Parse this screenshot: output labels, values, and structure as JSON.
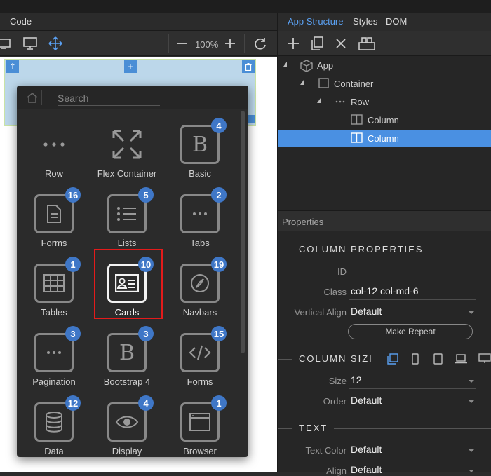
{
  "editor": {
    "code_tab": "Code",
    "zoom": "100%"
  },
  "popup": {
    "search_placeholder": "Search",
    "items": [
      {
        "label": "Row",
        "badge": ""
      },
      {
        "label": "Flex Container",
        "badge": ""
      },
      {
        "label": "Basic",
        "badge": "4"
      },
      {
        "label": "Forms",
        "badge": "16"
      },
      {
        "label": "Lists",
        "badge": "5"
      },
      {
        "label": "Tabs",
        "badge": "2"
      },
      {
        "label": "Tables",
        "badge": "1"
      },
      {
        "label": "Cards",
        "badge": "10"
      },
      {
        "label": "Navbars",
        "badge": "19"
      },
      {
        "label": "Pagination",
        "badge": "3"
      },
      {
        "label": "Bootstrap 4",
        "badge": "3"
      },
      {
        "label": "Forms",
        "badge": "15"
      },
      {
        "label": "Data",
        "badge": "12"
      },
      {
        "label": "Display",
        "badge": "4"
      },
      {
        "label": "Browser",
        "badge": "1"
      }
    ]
  },
  "right": {
    "tabs": [
      "App Structure",
      "Styles",
      "DOM"
    ],
    "tree": [
      {
        "label": "App"
      },
      {
        "label": "Container"
      },
      {
        "label": "Row"
      },
      {
        "label": "Column"
      },
      {
        "label": "Column"
      }
    ],
    "properties_header": "Properties",
    "column_properties": {
      "title": "COLUMN PROPERTIES",
      "id_label": "ID",
      "id_value": "",
      "class_label": "Class",
      "class_value": "col-12 col-md-6",
      "valign_label": "Vertical Align",
      "valign_value": "Default",
      "repeat_button": "Make Repeat"
    },
    "column_sizing": {
      "title": "COLUMN SIZI",
      "size_label": "Size",
      "size_value": "12",
      "order_label": "Order",
      "order_value": "Default"
    },
    "text": {
      "title": "TEXT",
      "color_label": "Text Color",
      "color_value": "Default",
      "align_label": "Align",
      "align_value": "Default"
    }
  },
  "colors": {
    "accent": "#4a90e2",
    "badge": "#3f77c7",
    "highlight": "#e31b1b"
  }
}
